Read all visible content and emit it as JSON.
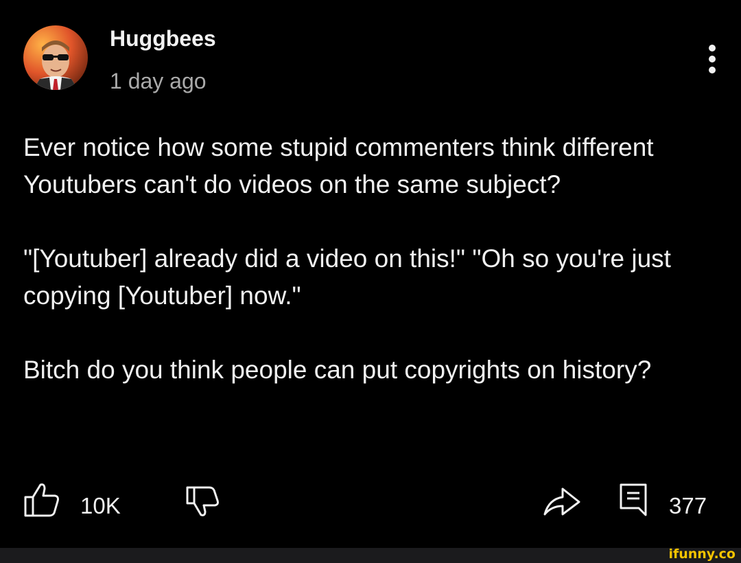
{
  "comment": {
    "author": "Huggbees",
    "timestamp": "1 day ago",
    "paragraphs": [
      "Ever notice how some stupid commenters think different Youtubers can't do videos on the same subject?",
      "\"[Youtuber] already did a video on this!\" \"Oh so you're just copying [Youtuber] now.\"",
      "Bitch do you think people can put copyrights on history?"
    ]
  },
  "actions": {
    "like_count": "10K",
    "reply_count": "377",
    "icons": [
      "thumbs-up-icon",
      "thumbs-down-icon",
      "share-icon",
      "comment-icon",
      "more-vertical-icon"
    ]
  },
  "footer": {
    "watermark": "ifunny.co"
  },
  "colors": {
    "background": "#000000",
    "text": "#f1f1f1",
    "muted": "#aaaaaa",
    "watermark": "#f5c400"
  }
}
